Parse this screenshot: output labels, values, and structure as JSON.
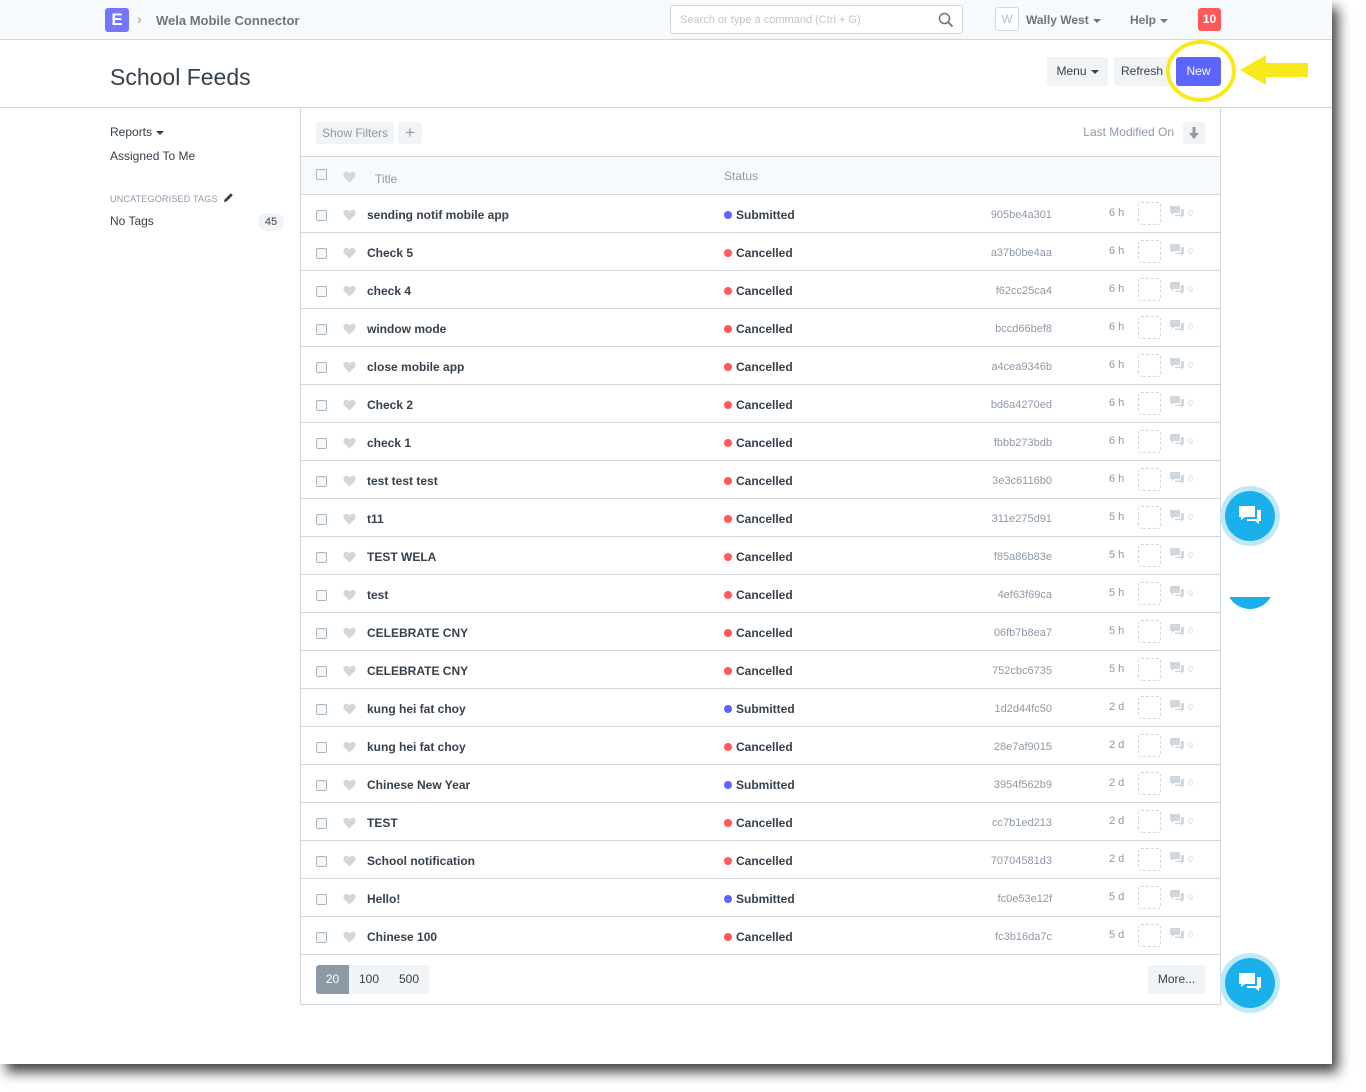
{
  "navbar": {
    "app_letter": "E",
    "breadcrumb": "Wela Mobile Connector",
    "search_placeholder": "Search or type a command (Ctrl + G)",
    "avatar_letter": "W",
    "user_name": "Wally West",
    "help_label": "Help",
    "notification_count": "10"
  },
  "page": {
    "title": "School Feeds",
    "menu_label": "Menu",
    "refresh_label": "Refresh",
    "new_label": "New",
    "highlight_color": "#f8ea1a",
    "primary_color": "#5e64ff"
  },
  "sidebar": {
    "reports_label": "Reports",
    "assigned_label": "Assigned To Me",
    "tags_heading": "UNCATEGORISED TAGS",
    "no_tags_label": "No Tags",
    "no_tags_count": "45"
  },
  "list": {
    "show_filters_label": "Show Filters",
    "add_filter_label": "+",
    "sort_label": "Last Modified On",
    "columns": {
      "title": "Title",
      "status": "Status"
    },
    "status_colors": {
      "Submitted": "#5e64ff",
      "Cancelled": "#ff5858"
    },
    "rows": [
      {
        "title": "sending notif mobile app",
        "status": "Submitted",
        "id": "905be4a301",
        "time": "6 h",
        "comments": "0"
      },
      {
        "title": "Check 5",
        "status": "Cancelled",
        "id": "a37b0be4aa",
        "time": "6 h",
        "comments": "0"
      },
      {
        "title": "check 4",
        "status": "Cancelled",
        "id": "f62cc25ca4",
        "time": "6 h",
        "comments": "0"
      },
      {
        "title": "window mode",
        "status": "Cancelled",
        "id": "bccd66bef8",
        "time": "6 h",
        "comments": "0"
      },
      {
        "title": "close mobile app",
        "status": "Cancelled",
        "id": "a4cea9346b",
        "time": "6 h",
        "comments": "0"
      },
      {
        "title": "Check 2",
        "status": "Cancelled",
        "id": "bd6a4270ed",
        "time": "6 h",
        "comments": "0"
      },
      {
        "title": "check 1",
        "status": "Cancelled",
        "id": "fbbb273bdb",
        "time": "6 h",
        "comments": "0"
      },
      {
        "title": "test test test",
        "status": "Cancelled",
        "id": "3e3c6116b0",
        "time": "6 h",
        "comments": "0"
      },
      {
        "title": "t11",
        "status": "Cancelled",
        "id": "311e275d91",
        "time": "5 h",
        "comments": "0"
      },
      {
        "title": "TEST WELA",
        "status": "Cancelled",
        "id": "f85a86b83e",
        "time": "5 h",
        "comments": "0"
      },
      {
        "title": "test",
        "status": "Cancelled",
        "id": "4ef63f69ca",
        "time": "5 h",
        "comments": "0"
      },
      {
        "title": "CELEBRATE CNY",
        "status": "Cancelled",
        "id": "06fb7b8ea7",
        "time": "5 h",
        "comments": "0"
      },
      {
        "title": "CELEBRATE CNY",
        "status": "Cancelled",
        "id": "752cbc6735",
        "time": "5 h",
        "comments": "0"
      },
      {
        "title": "kung hei fat choy",
        "status": "Submitted",
        "id": "1d2d44fc50",
        "time": "2 d",
        "comments": "0"
      },
      {
        "title": "kung hei fat choy",
        "status": "Cancelled",
        "id": "28e7af9015",
        "time": "2 d",
        "comments": "0"
      },
      {
        "title": "Chinese New Year",
        "status": "Submitted",
        "id": "3954f562b9",
        "time": "2 d",
        "comments": "0"
      },
      {
        "title": "TEST",
        "status": "Cancelled",
        "id": "cc7b1ed213",
        "time": "2 d",
        "comments": "0"
      },
      {
        "title": "School notification",
        "status": "Cancelled",
        "id": "70704581d3",
        "time": "2 d",
        "comments": "0"
      },
      {
        "title": "Hello!",
        "status": "Submitted",
        "id": "fc0e53e12f",
        "time": "5 d",
        "comments": "0"
      },
      {
        "title": "Chinese 100",
        "status": "Cancelled",
        "id": "fc3b16da7c",
        "time": "5 d",
        "comments": "0"
      }
    ],
    "page_sizes": [
      "20",
      "100",
      "500"
    ],
    "active_page_size": "20",
    "more_label": "More..."
  }
}
